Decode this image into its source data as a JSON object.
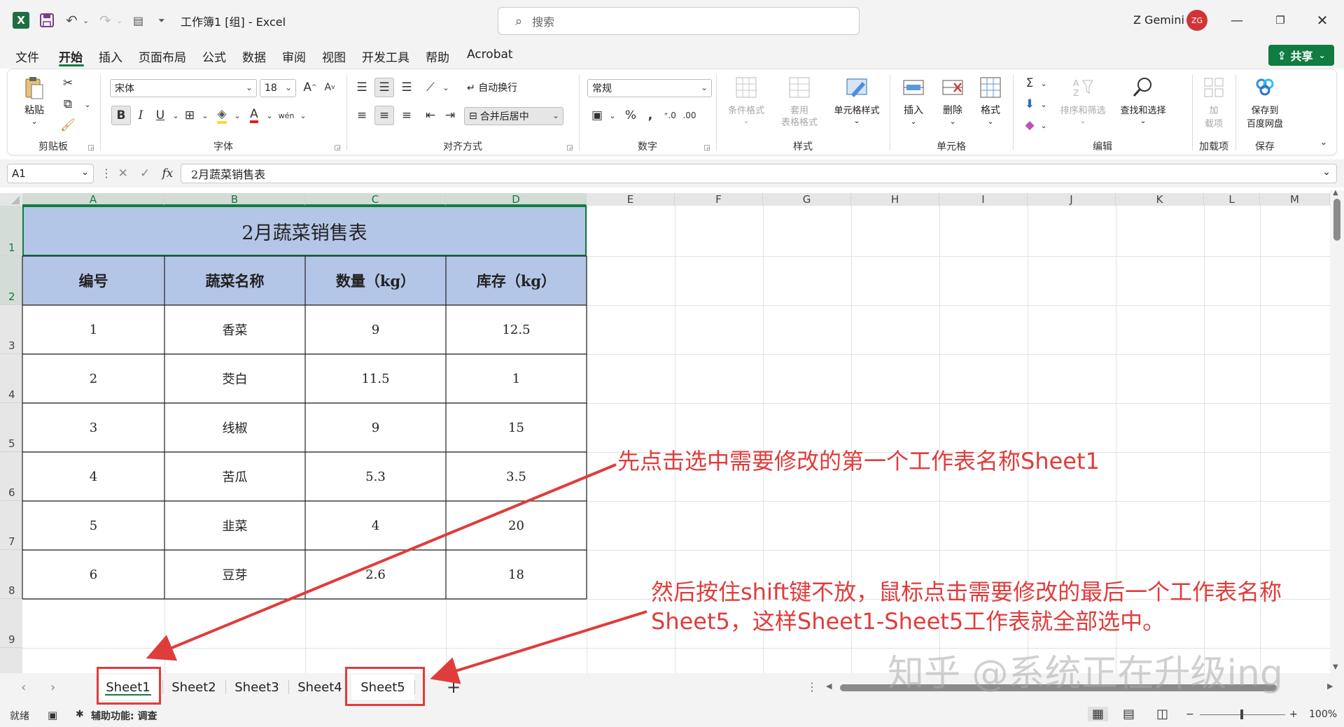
{
  "titlebar": {
    "title": "工作簿1 [组] - Excel",
    "search_placeholder": "搜索",
    "user_name": "Z Gemini",
    "user_initials": "ZG"
  },
  "menu": {
    "items": [
      "文件",
      "开始",
      "插入",
      "页面布局",
      "公式",
      "数据",
      "审阅",
      "视图",
      "开发工具",
      "帮助",
      "Acrobat"
    ],
    "active": "开始",
    "share_label": "共享"
  },
  "ribbon": {
    "clipboard": {
      "label": "剪贴板",
      "paste": "粘贴"
    },
    "font": {
      "label": "字体",
      "name": "宋体",
      "size": "18"
    },
    "alignment": {
      "label": "对齐方式",
      "wrap": "自动换行",
      "merge": "合并后居中"
    },
    "number": {
      "label": "数字",
      "format": "常规"
    },
    "styles": {
      "label": "样式",
      "conditional": "条件格式",
      "table_format_1": "套用",
      "table_format_2": "表格格式",
      "cell_styles": "单元格样式"
    },
    "cells": {
      "label": "单元格",
      "insert": "插入",
      "delete": "删除",
      "format": "格式"
    },
    "editing": {
      "label": "编辑",
      "sort": "排序和筛选",
      "find": "查找和选择"
    },
    "addins": {
      "label": "加载项",
      "btn_1": "加",
      "btn_2": "载项"
    },
    "save": {
      "label": "保存",
      "btn_1": "保存到",
      "btn_2": "百度网盘"
    }
  },
  "formula_bar": {
    "name_box": "A1",
    "fx": "fx",
    "content": "2月蔬菜销售表"
  },
  "sheet": {
    "columns": [
      "A",
      "B",
      "C",
      "D",
      "E",
      "F",
      "G",
      "H",
      "I",
      "J",
      "K",
      "L",
      "M"
    ],
    "rows": [
      "1",
      "2",
      "3",
      "4",
      "5",
      "6",
      "7",
      "8",
      "9"
    ],
    "title": "2月蔬菜销售表",
    "headers": [
      "编号",
      "蔬菜名称",
      "数量（kg）",
      "库存（kg）"
    ],
    "data": [
      [
        "1",
        "香菜",
        "9",
        "12.5"
      ],
      [
        "2",
        "茭白",
        "11.5",
        "1"
      ],
      [
        "3",
        "线椒",
        "9",
        "15"
      ],
      [
        "4",
        "苦瓜",
        "5.3",
        "3.5"
      ],
      [
        "5",
        "韭菜",
        "4",
        "20"
      ],
      [
        "6",
        "豆芽",
        "2.6",
        "18"
      ]
    ]
  },
  "tabs": {
    "sheets": [
      "Sheet1",
      "Sheet2",
      "Sheet3",
      "Sheet4",
      "Sheet5"
    ],
    "active": "Sheet1",
    "add": "+"
  },
  "status": {
    "ready": "就绪",
    "accessibility": "辅助功能: 调查",
    "zoom": "100%"
  },
  "annotations": {
    "step1": "先点击选中需要修改的第一个工作表名称Sheet1",
    "step2_line1": "然后按住shift键不放，鼠标点击需要修改的最后一个工作表名称",
    "step2_line2": "Sheet5，这样Sheet1-Sheet5工作表就全部选中。",
    "watermark": "知乎 @系统正在升级ing"
  },
  "colors": {
    "excel_green": "#107c41",
    "header_fill": "#b4c6e7",
    "annotation_red": "#e03c3c",
    "avatar_red": "#d13438"
  }
}
